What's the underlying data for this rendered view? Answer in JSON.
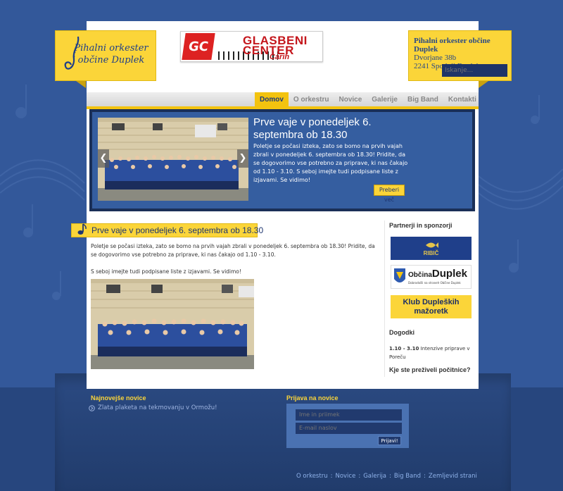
{
  "logo": {
    "line1": "Pihalni orkester",
    "line2": "občine Duplek"
  },
  "top_sponsor": {
    "mark": "GC",
    "line1": "GLASBENI",
    "line2": "CENTER",
    "line3": "Carih"
  },
  "address": {
    "name": "Pihalni orkester občine Duplek",
    "street": "Dvorjane 38b",
    "city": "2241 Spodnji Duplek",
    "search_placeholder": "Iskanje..."
  },
  "nav": {
    "items": [
      {
        "label": "Domov",
        "active": true
      },
      {
        "label": "O orkestru",
        "active": false
      },
      {
        "label": "Novice",
        "active": false
      },
      {
        "label": "Galerije",
        "active": false
      },
      {
        "label": "Big Band",
        "active": false
      },
      {
        "label": "Kontakti",
        "active": false
      }
    ]
  },
  "featured": {
    "title": "Prve vaje v ponedeljek 6. septembra ob 18.30",
    "text": "Poletje se počasi izteka, zato se bomo na prvih vajah zbrali v ponedeljek 6. septembra ob 18.30! Pridite, da se dogovorimo vse potrebno za priprave, ki nas čakajo od 1.10 - 3.10.  S seboj imejte tudi podpisane liste z izjavami. Se vidimo!",
    "more": "Preberi več",
    "prev": "❮",
    "next": "❯"
  },
  "article": {
    "title": "Prve vaje v ponedeljek 6. septembra ob 18.30",
    "p1": "Poletje se počasi izteka, zato se bomo na prvih vajah zbrali v ponedeljek 6. septembra ob 18.30! Pridite, da se dogovorimo vse potrebno za priprave, ki nas čakajo od 1.10 - 3.10.",
    "p2": " S seboj imejte tudi podpisane liste z izjavami. Se vidimo!"
  },
  "sidebar": {
    "partners_heading": "Partnerji in sponzorji",
    "sponsor1": "RIBIČ",
    "sponsor2_a": "Občina",
    "sponsor2_b": "Duplek",
    "sponsor2_tag": "Dobrodošli na straneh Občine Duplek",
    "sponsor3": "Klub Dupleških mažoretk",
    "events_heading": "Dogodki",
    "event_date": "1.10 - 3.10",
    "event_text": " Intenzive priprave v Poreču",
    "poll": "Kje ste preživeli počitnice?"
  },
  "footer": {
    "news_heading": "Najnovejše novice",
    "news_item": "Zlata plaketa na tekmovanju v Ormožu!",
    "login_heading": "Prijava na novice",
    "name_placeholder": "Ime in priimek",
    "email_placeholder": "E-mail naslov",
    "submit": "Prijavi!",
    "links": [
      "O orkestru",
      "Novice",
      "Galerija",
      "Big Band",
      "Zemljevid strani"
    ],
    "separator": ":"
  },
  "colors": {
    "accent": "#fbd539",
    "navy": "#1d3a78",
    "background": "#33589a"
  }
}
